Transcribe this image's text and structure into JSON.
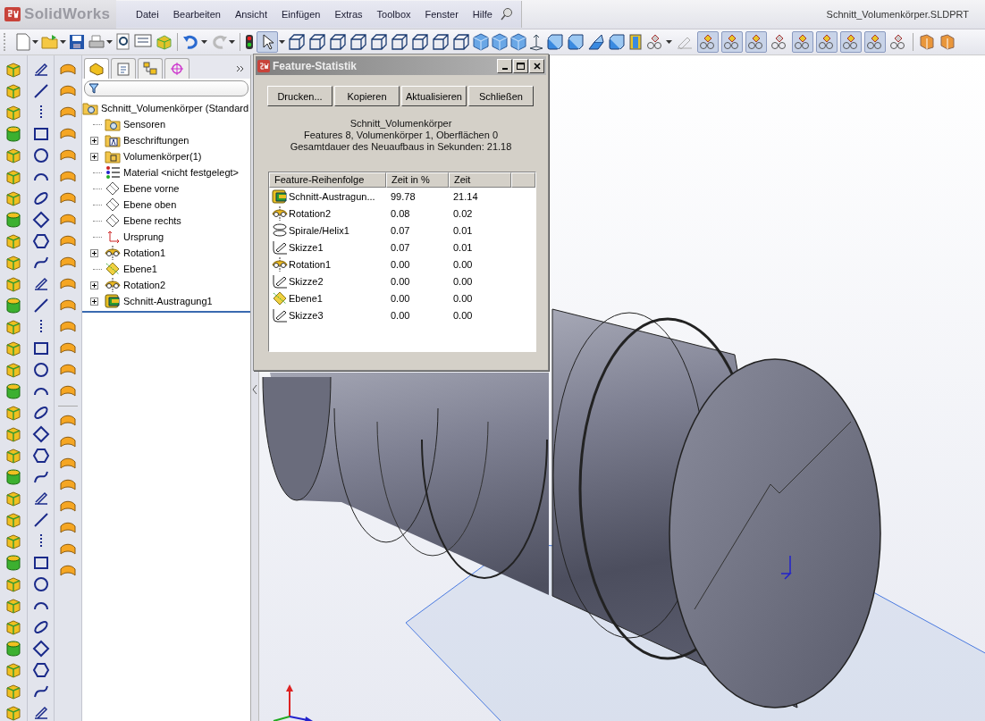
{
  "app": {
    "logo": "SolidWorks"
  },
  "menu": [
    "Datei",
    "Bearbeiten",
    "Ansicht",
    "Einfügen",
    "Extras",
    "Toolbox",
    "Fenster",
    "Hilfe"
  ],
  "document_title": "Schnitt_Volumenkörper.SLDPRT",
  "feature_tree": {
    "root": "Schnitt_Volumenkörper  (Standard",
    "items": [
      {
        "label": "Sensoren",
        "kind": "sensor-folder",
        "expandable": false
      },
      {
        "label": "Beschriftungen",
        "kind": "annotation-folder",
        "expandable": true
      },
      {
        "label": "Volumenkörper(1)",
        "kind": "body-folder",
        "expandable": true
      },
      {
        "label": "Material <nicht festgelegt>",
        "kind": "material",
        "expandable": false
      },
      {
        "label": "Ebene vorne",
        "kind": "plane",
        "expandable": false
      },
      {
        "label": "Ebene oben",
        "kind": "plane",
        "expandable": false
      },
      {
        "label": "Ebene rechts",
        "kind": "plane",
        "expandable": false
      },
      {
        "label": "Ursprung",
        "kind": "origin",
        "expandable": false
      },
      {
        "label": "Rotation1",
        "kind": "revolve",
        "expandable": true
      },
      {
        "label": "Ebene1",
        "kind": "ref-plane",
        "expandable": false
      },
      {
        "label": "Rotation2",
        "kind": "revolve",
        "expandable": true
      },
      {
        "label": "Schnitt-Austragung1",
        "kind": "loft",
        "expandable": true
      }
    ]
  },
  "dialog": {
    "title": "Feature-Statistik",
    "buttons": [
      "Drucken...",
      "Kopieren",
      "Aktualisieren",
      "Schließen"
    ],
    "summary": [
      "Schnitt_Volumenkörper",
      "Features 8, Volumenkörper 1, Oberflächen 0",
      "Gesamtdauer des Neuaufbaus in Sekunden: 21.18"
    ],
    "columns": [
      "Feature-Reihenfolge",
      "Zeit in %",
      "Zeit"
    ],
    "rows": [
      {
        "kind": "loft",
        "name": "Schnitt-Austragun...",
        "percent": "99.78",
        "time": "21.14"
      },
      {
        "kind": "revolve",
        "name": "Rotation2",
        "percent": "0.08",
        "time": "0.02"
      },
      {
        "kind": "helix",
        "name": "Spirale/Helix1",
        "percent": "0.07",
        "time": "0.01"
      },
      {
        "kind": "sketch",
        "name": "Skizze1",
        "percent": "0.07",
        "time": "0.01"
      },
      {
        "kind": "revolve",
        "name": "Rotation1",
        "percent": "0.00",
        "time": "0.00"
      },
      {
        "kind": "sketch",
        "name": "Skizze2",
        "percent": "0.00",
        "time": "0.00"
      },
      {
        "kind": "ref-plane",
        "name": "Ebene1",
        "percent": "0.00",
        "time": "0.00"
      },
      {
        "kind": "sketch",
        "name": "Skizze3",
        "percent": "0.00",
        "time": "0.00"
      }
    ]
  }
}
